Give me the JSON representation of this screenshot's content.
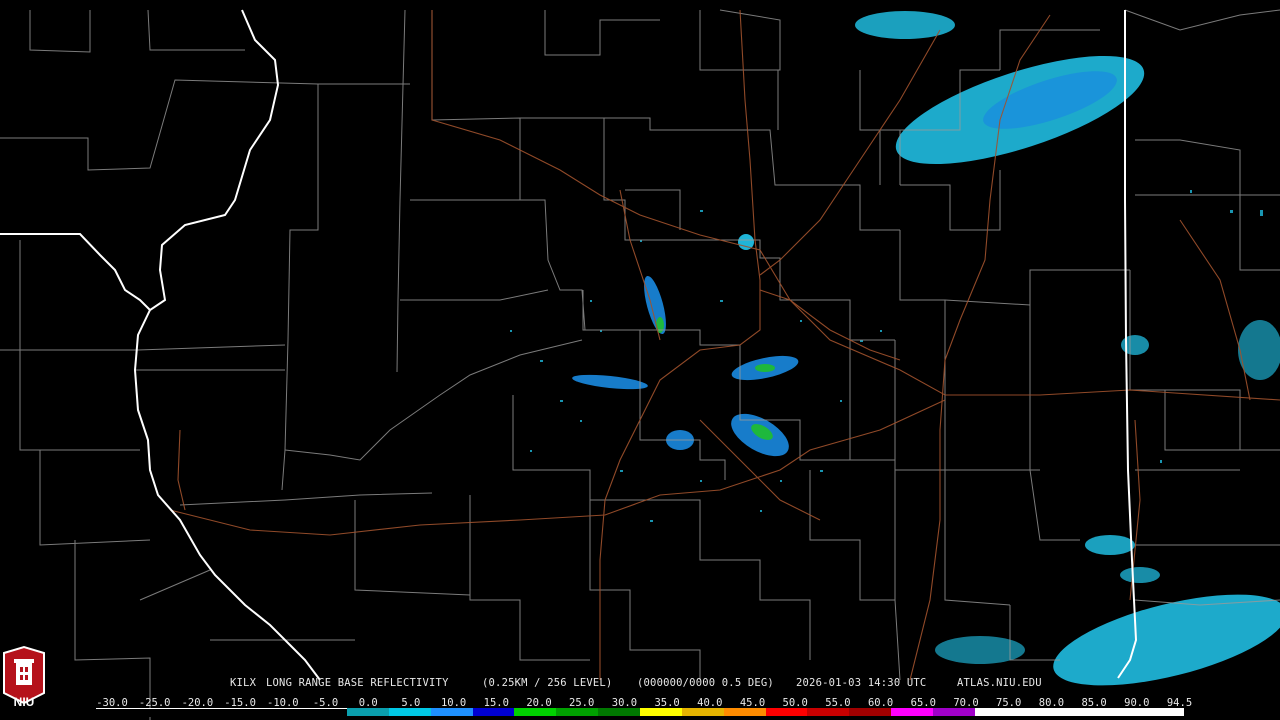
{
  "caption": {
    "radar": "KILX",
    "product": "LONG RANGE BASE REFLECTIVITY",
    "resolution": "(0.25KM / 256 LEVEL)",
    "volume": "(000000/0000 0.5 DEG)",
    "timestamp": "2026-01-03 14:30 UTC",
    "source": "ATLAS.NIU.EDU"
  },
  "legend": {
    "labels": [
      "-30.0",
      "-25.0",
      "-20.0",
      "-15.0",
      "-10.0",
      "-5.0",
      "0.0",
      "5.0",
      "10.0",
      "15.0",
      "20.0",
      "25.0",
      "30.0",
      "35.0",
      "40.0",
      "45.0",
      "50.0",
      "55.0",
      "60.0",
      "65.0",
      "70.0",
      "75.0",
      "80.0",
      "85.0",
      "90.0",
      "94.5"
    ],
    "colors": [
      "#000000",
      "#000000",
      "#000000",
      "#000000",
      "#000000",
      "#000000",
      "#0a9fae",
      "#00c8e6",
      "#1e90ff",
      "#0000d2",
      "#00d200",
      "#00a000",
      "#007800",
      "#ffff00",
      "#e6b400",
      "#ff8c00",
      "#ff0000",
      "#c80000",
      "#a00000",
      "#ff00ff",
      "#a000c8",
      "#ffffff",
      "#ffffff",
      "#ffffff",
      "#ffffff",
      "#ffffff"
    ]
  },
  "logo": {
    "text": "NIU"
  },
  "colors": {
    "state_borders": "#ffffff",
    "county_lines": "#9a9a9a",
    "highways": "#a0522d",
    "light_echo": "#22c8ee",
    "moderate_echo": "#1a6ad8",
    "strong_echo": "#22cc44"
  }
}
